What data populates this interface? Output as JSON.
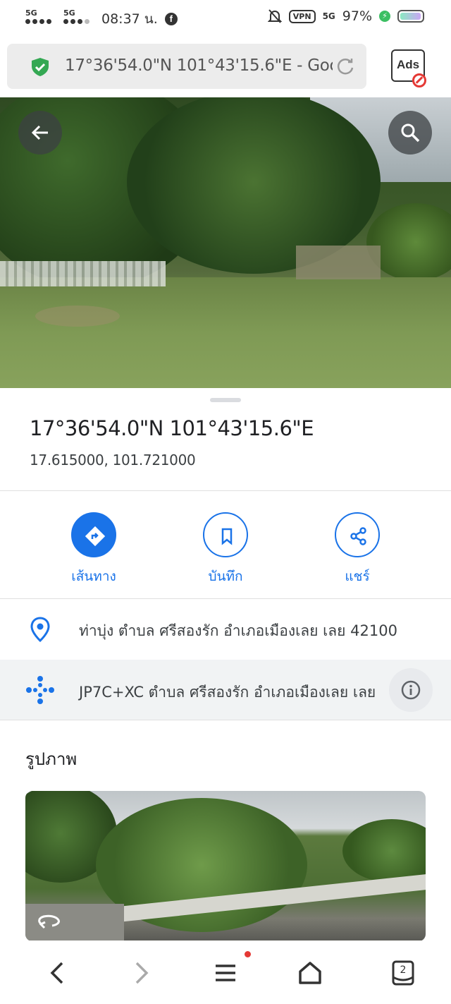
{
  "status_bar": {
    "net1": "5G",
    "net2": "5G",
    "time": "08:37 น.",
    "app_icon": "facebook-icon",
    "vpn": "VPN",
    "net_right": "5G",
    "battery": "97%"
  },
  "browser": {
    "url": "17°36'54.0\"N 101°43'15.6\"E - Google ...",
    "ads_label": "Ads"
  },
  "place": {
    "title": "17°36'54.0\"N 101°43'15.6\"E",
    "decimal": "17.615000, 101.721000"
  },
  "actions": {
    "route": "เส้นทาง",
    "save": "บันทึก",
    "share": "แชร์"
  },
  "details": {
    "address": "ท่าบุ่ง ตำบล ศรีสองรัก อำเภอเมืองเลย เลย 42100",
    "plus_code": "JP7C+XC ตำบล ศรีสองรัก อำเภอเมืองเลย เลย"
  },
  "photos": {
    "heading": "รูปภาพ"
  },
  "colors": {
    "accent": "#1a73e8",
    "secure": "#34a853",
    "notification": "#e53935"
  }
}
